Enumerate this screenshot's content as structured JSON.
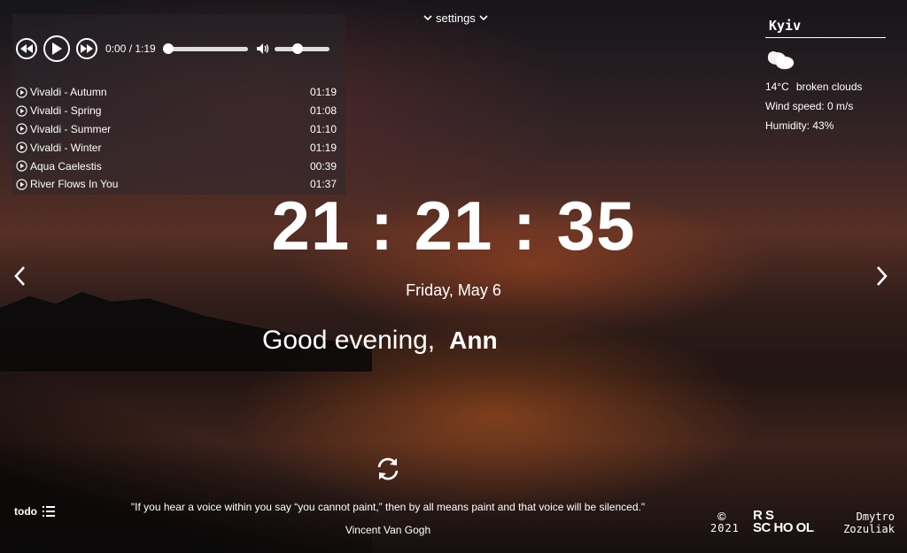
{
  "settings": {
    "label": "settings"
  },
  "player": {
    "time": "0:00 / 1:19",
    "progress": 0,
    "volume": 0.4,
    "playlist": [
      {
        "title": "Vivaldi - Autumn",
        "duration": "01:19"
      },
      {
        "title": "Vivaldi - Spring",
        "duration": "01:08"
      },
      {
        "title": "Vivaldi - Summer",
        "duration": "01:10"
      },
      {
        "title": "Vivaldi - Winter",
        "duration": "01:19"
      },
      {
        "title": "Aqua Caelestis",
        "duration": "00:39"
      },
      {
        "title": "River Flows In You",
        "duration": "01:37"
      }
    ]
  },
  "weather": {
    "city": "Kyiv",
    "icon": "broken-clouds-icon",
    "temperature": "14°C",
    "description": "broken clouds",
    "wind": "Wind speed: 0 m/s",
    "humidity": "Humidity: 43%"
  },
  "clock": {
    "time": "21 : 21 : 35"
  },
  "date": "Friday, May 6",
  "greeting": {
    "text": "Good evening,",
    "name": "Ann"
  },
  "quote": {
    "text": "\"If you hear a voice within you say “you cannot paint,” then by all means paint and that voice will be silenced.\"",
    "author": "Vincent Van Gogh"
  },
  "todo": {
    "label": "todo"
  },
  "footer": {
    "copyright_mark": "©",
    "year": "2021",
    "school_logo_line1": "R S",
    "school_logo_line2": "SC HO OL",
    "author_first": "Dmytro",
    "author_last": "Zozuliak"
  }
}
